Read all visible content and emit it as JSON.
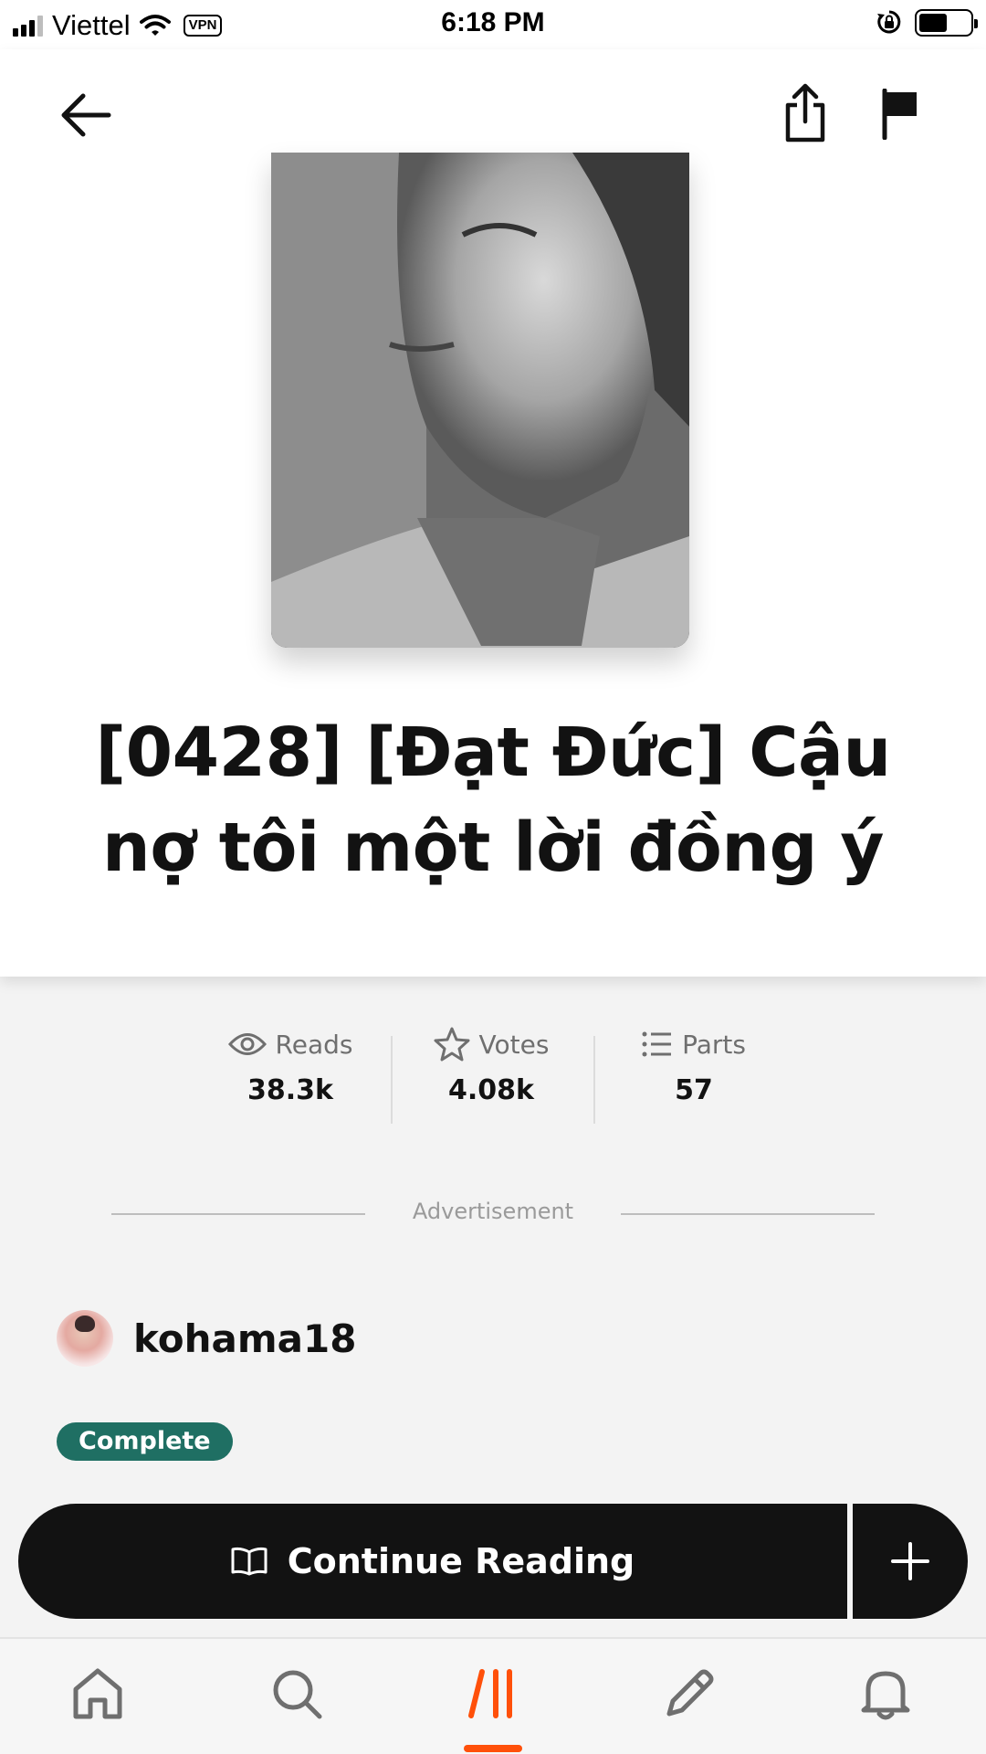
{
  "status_bar": {
    "carrier": "Viettel",
    "vpn": "VPN",
    "time": "6:18 PM",
    "battery_level": 0.55
  },
  "header": {
    "icons": [
      "back-arrow-icon",
      "share-icon",
      "flag-icon"
    ]
  },
  "story": {
    "title": "[0428] [Đạt Đức] Cậu nợ tôi một lời đồng ý"
  },
  "stats": {
    "reads": {
      "label": "Reads",
      "value": "38.3k",
      "icon": "eye-icon"
    },
    "votes": {
      "label": "Votes",
      "value": "4.08k",
      "icon": "star-icon"
    },
    "parts": {
      "label": "Parts",
      "value": "57",
      "icon": "list-icon"
    }
  },
  "ad": {
    "label": "Advertisement"
  },
  "author": {
    "name": "kohama18"
  },
  "status_badge": {
    "label": "Complete",
    "color": "#1f6f63"
  },
  "cta": {
    "continue_label": "Continue Reading",
    "icon": "book-open-icon",
    "add_icon": "plus-icon"
  },
  "tab_bar": {
    "tabs": [
      "home-icon",
      "search-icon",
      "library-icon",
      "write-icon",
      "bell-icon"
    ],
    "active": "library",
    "accent": "#ff500a"
  }
}
